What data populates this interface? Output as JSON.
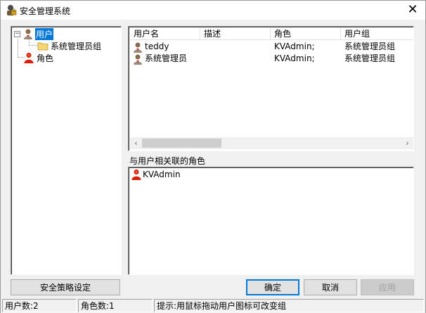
{
  "window": {
    "title": "安全管理系统",
    "close_glyph": "✕"
  },
  "tree": {
    "root": {
      "label": "用户",
      "expander": "−",
      "icon": "user-icon"
    },
    "child": {
      "label": "系统管理员组",
      "icon": "folder-icon"
    },
    "roles": {
      "label": "角色",
      "icon": "role-icon"
    }
  },
  "users_table": {
    "columns": [
      "用户名",
      "描述",
      "角色",
      "用户组"
    ],
    "rows": [
      {
        "name": "teddy",
        "description": "",
        "role": "KVAdmin;",
        "group": "系统管理员组"
      },
      {
        "name": "系统管理员",
        "description": "",
        "role": "KVAdmin;",
        "group": "系统管理员组"
      }
    ],
    "scroll_left": "‹",
    "scroll_right": "›"
  },
  "associated_roles": {
    "label": "与用户相关联的角色",
    "items": [
      {
        "name": "KVAdmin",
        "icon": "role-icon"
      }
    ]
  },
  "buttons": {
    "policy": "安全策略设定",
    "ok": "确定",
    "cancel": "取消",
    "apply": "应用"
  },
  "status": {
    "user_count": "用户数:2",
    "role_count": "角色数:1",
    "hint": "提示:用鼠标拖动用户图标可改变组"
  },
  "colors": {
    "selection": "#0078d7",
    "role_red": "#d81e06",
    "folder_yellow": "#f7d674"
  }
}
